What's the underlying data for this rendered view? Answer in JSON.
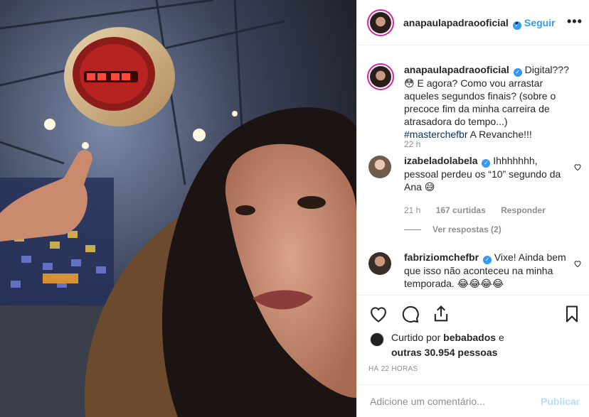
{
  "post": {
    "username": "anapaulapadraooficial",
    "separator": "•",
    "follow_label": "Seguir",
    "more_icon": "more-options-icon"
  },
  "caption": {
    "username": "anapaulapadraooficial",
    "text": "Digital??? 😳 E agora? Como vou arrastar aqueles segundos finais? (sobre o precoce fim da minha carreira de atrasadora do tempo...)",
    "hashtag": "#masterchefbr",
    "tail": "A Revanche!!!",
    "time": "22 h"
  },
  "comments": [
    {
      "username": "izabeladolabela",
      "text": "Ihhhhhhh, pessoal perdeu os “10” segundo da Ana 😅",
      "time": "21 h",
      "likes": "167 curtidas",
      "reply": "Responder",
      "view_replies": "Ver respostas (2)"
    },
    {
      "username": "fabriziomchefbr",
      "text": "Vixe! Ainda bem que isso não aconteceu na minha temporada. 😂😂😂😂"
    }
  ],
  "likes": {
    "prefix": "Curtido por",
    "by": "bebabados",
    "and": "e",
    "others": "outras 30.954 pessoas"
  },
  "timestamp": "HÁ 22 HORAS",
  "add_comment": {
    "placeholder": "Adicione um comentário...",
    "publish": "Publicar"
  },
  "colors": {
    "accent": "#3897f0",
    "publish_disabled": "#b2dffc",
    "muted": "#8e8e8e"
  }
}
